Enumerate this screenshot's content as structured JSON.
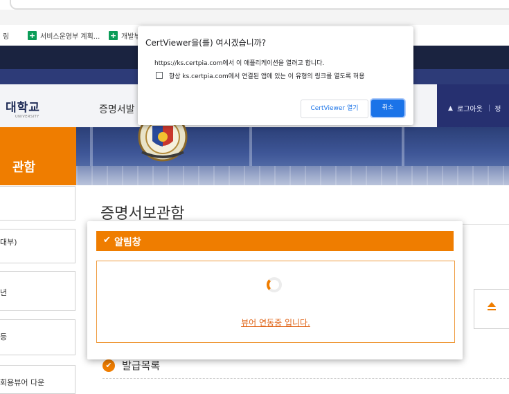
{
  "bookmarks": [
    {
      "label": "서비스운영부 계획..."
    },
    {
      "label": "개발부"
    }
  ],
  "bookmark_prefix": "링",
  "site": {
    "logo": "대학교",
    "logo_sub": "UNIVERSITY",
    "menu_item": "증명서발",
    "logout": "로그아웃",
    "extra": "정"
  },
  "sidebar": {
    "title": "관함",
    "items": [
      {
        "label": ""
      },
      {
        "label": "대부)"
      },
      {
        "label": "년"
      },
      {
        "label": "등"
      },
      {
        "label": "회용뷰어 다운"
      }
    ]
  },
  "main": {
    "page_title": "증명서보관함",
    "list_heading": "발급목록"
  },
  "alert": {
    "check": "✔",
    "title": "알림창",
    "message": "뷰어 연동중 입니다."
  },
  "dialog": {
    "title": "CertViewer을(를) 여시겠습니까?",
    "description": "https://ks.certpia.com에서 이 애플리케이션을 열려고 합니다.",
    "checkbox_label": "항상 ks.certpia.com에서 연결된 앱에 있는 이 유형의 링크를 열도록 허용",
    "open_label": "CertViewer 열기",
    "cancel_label": "취소"
  },
  "colors": {
    "accent": "#ef7d00",
    "nav_dark": "#1a2340",
    "nav_blue": "#2d3b78",
    "primary_button": "#1a73e8"
  }
}
